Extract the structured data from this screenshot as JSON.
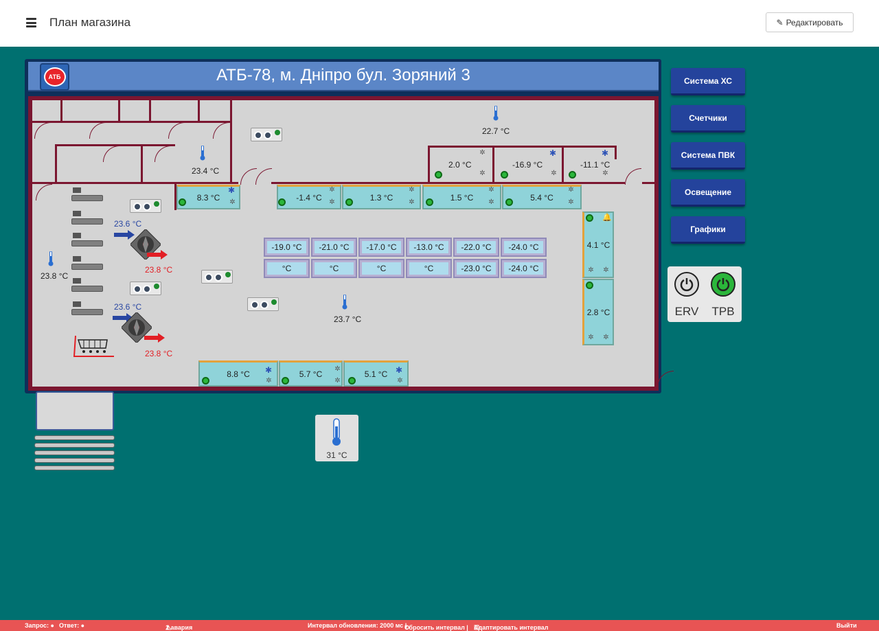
{
  "header": {
    "title": "План магазина",
    "edit_label": "Редактировать"
  },
  "plan": {
    "title": "АТБ-78, м. Дніпро бул. Зоряний 3",
    "logo_text": "АТБ"
  },
  "room_temps": {
    "left": "23.8 °C",
    "office": "23.4 °C",
    "back": "22.7 °C",
    "center": "23.7 °C"
  },
  "cold_rooms": [
    "2.0 °C",
    "-16.9 °C",
    "-11.1 °C"
  ],
  "fridges_top": [
    "8.3 °C",
    "-1.4 °C",
    "1.3 °C",
    "1.5 °C",
    "5.4 °C"
  ],
  "fridges_right": [
    "4.1 °C",
    "2.8 °C"
  ],
  "fridges_bottom": [
    "8.8 °C",
    "5.7 °C",
    "5.1 °C"
  ],
  "freezers_row1": [
    "-19.0 °C",
    "-21.0 °C",
    "-17.0 °C",
    "-13.0 °C",
    "-22.0 °C",
    "-24.0 °C"
  ],
  "freezers_row2": [
    "°C",
    "°C",
    "°C",
    "°C",
    "-23.0 °C",
    "-24.0 °C"
  ],
  "ahu": [
    {
      "in": "23.6 °C",
      "out": "23.8 °C"
    },
    {
      "in": "23.6 °C",
      "out": "23.8 °C"
    }
  ],
  "sidebar": {
    "buttons": [
      "Система ХС",
      "Счетчики",
      "Система ПВК",
      "Освещение",
      "Графики"
    ]
  },
  "power": {
    "erv_label": "ERV",
    "trv_label": "TPB",
    "erv_color": "#222222",
    "trv_color": "#2bb63b"
  },
  "outdoor": {
    "temp": "31 °C"
  },
  "footer": {
    "request": "Запрос: ●",
    "response": "Ответ: ●",
    "alarms": "1 авария",
    "interval": "Интервал обновления: 2000 мс |",
    "reset": "Сбросить интервал |",
    "adapt": "Адаптировать интервал",
    "logout": "Выйти"
  },
  "colors": {
    "background": "#007070",
    "wall": "#7b1630",
    "accent_button": "#24439c",
    "footer": "#e85454"
  }
}
